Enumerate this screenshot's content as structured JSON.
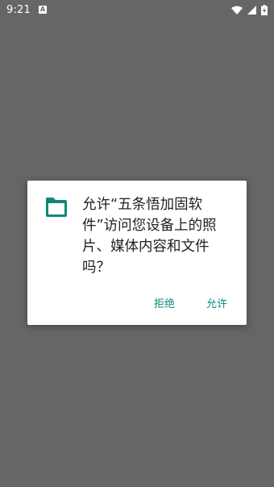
{
  "status_bar": {
    "time": "9:21",
    "notification_icon": "A",
    "icons": [
      "wifi-icon",
      "cell-signal-icon",
      "battery-charging-icon"
    ]
  },
  "dialog": {
    "icon": "folder-icon",
    "message": "允许“五条悟加固软件”访问您设备上的照片、媒体内容和文件吗？",
    "deny_label": "拒绝",
    "allow_label": "允许"
  },
  "colors": {
    "scrim": "#666666",
    "accent": "#0b8a7a",
    "dialog_bg": "#ffffff",
    "text": "#212121"
  }
}
